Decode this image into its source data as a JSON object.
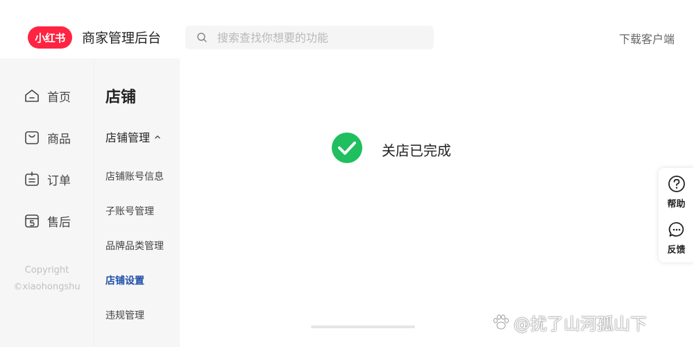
{
  "header": {
    "logo_text": "小红书",
    "app_title": "商家管理后台",
    "search_placeholder": "搜索查找你想要的功能",
    "download_label": "下载客户端",
    "brand_color": "#ff2442"
  },
  "nav_primary": {
    "items": [
      {
        "label": "首页",
        "icon": "home-icon"
      },
      {
        "label": "商品",
        "icon": "bag-icon"
      },
      {
        "label": "订单",
        "icon": "order-icon"
      },
      {
        "label": "售后",
        "icon": "after-sale-icon"
      }
    ],
    "copyright_line1": "Copyright",
    "copyright_line2": "©xiaohongshu"
  },
  "nav_secondary": {
    "title": "店铺",
    "group_label": "店铺管理",
    "items": [
      {
        "label": "店铺账号信息",
        "active": false
      },
      {
        "label": "子账号管理",
        "active": false
      },
      {
        "label": "品牌品类管理",
        "active": false
      },
      {
        "label": "店铺设置",
        "active": true
      },
      {
        "label": "违规管理",
        "active": false
      }
    ],
    "active_color": "#1f4ea8"
  },
  "main": {
    "status_text": "关店已完成",
    "success_color": "#1fbf5f"
  },
  "float_panel": {
    "help_label": "帮助",
    "feedback_label": "反馈"
  },
  "watermark": {
    "text": "@扰了山河孤山下"
  }
}
